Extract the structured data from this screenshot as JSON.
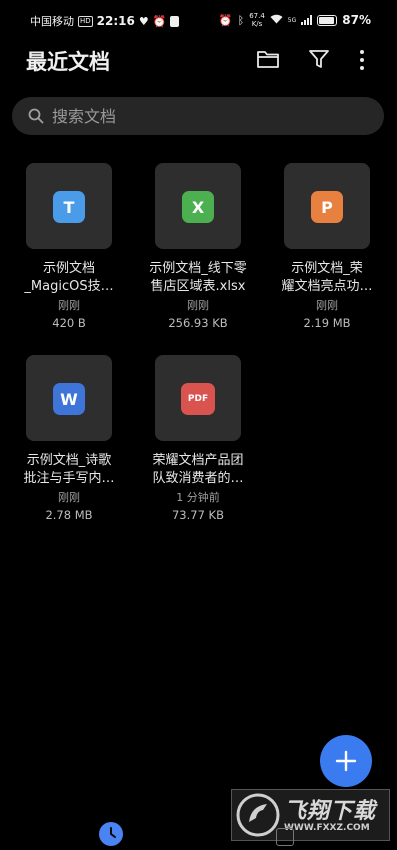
{
  "status_bar": {
    "carrier": "中国移动",
    "hd": "HD",
    "time": "22:16",
    "net_speed_value": "67.4",
    "net_speed_unit": "K/s",
    "signal_type": "5G",
    "battery": "87%"
  },
  "header": {
    "title": "最近文档"
  },
  "search": {
    "placeholder": "搜索文档"
  },
  "files": [
    {
      "badge": "T",
      "color": "#4a9be8",
      "name_line1": "示例文档",
      "name_line2": "_MagicOS技…",
      "time": "刚刚",
      "size": "420 B"
    },
    {
      "badge": "X",
      "color": "#4caf50",
      "name_line1": "示例文档_线下零",
      "name_line2": "售店区域表.xlsx",
      "time": "刚刚",
      "size": "256.93 KB"
    },
    {
      "badge": "P",
      "color": "#e8813f",
      "name_line1": "示例文档_荣",
      "name_line2": "耀文档亮点功…",
      "time": "刚刚",
      "size": "2.19 MB"
    },
    {
      "badge": "W",
      "color": "#3f74d9",
      "name_line1": "示例文档_诗歌",
      "name_line2": "批注与手写内…",
      "time": "刚刚",
      "size": "2.78 MB"
    },
    {
      "badge": "PDF",
      "color": "#d9534f",
      "name_line1": "荣耀文档产品团",
      "name_line2": "队致消费者的…",
      "time": "1 分钟前",
      "size": "73.77 KB"
    }
  ],
  "watermark": {
    "text": "飞翔下载",
    "url": "WWW.FXXZ.COM"
  },
  "accent": "#3b7bf0"
}
